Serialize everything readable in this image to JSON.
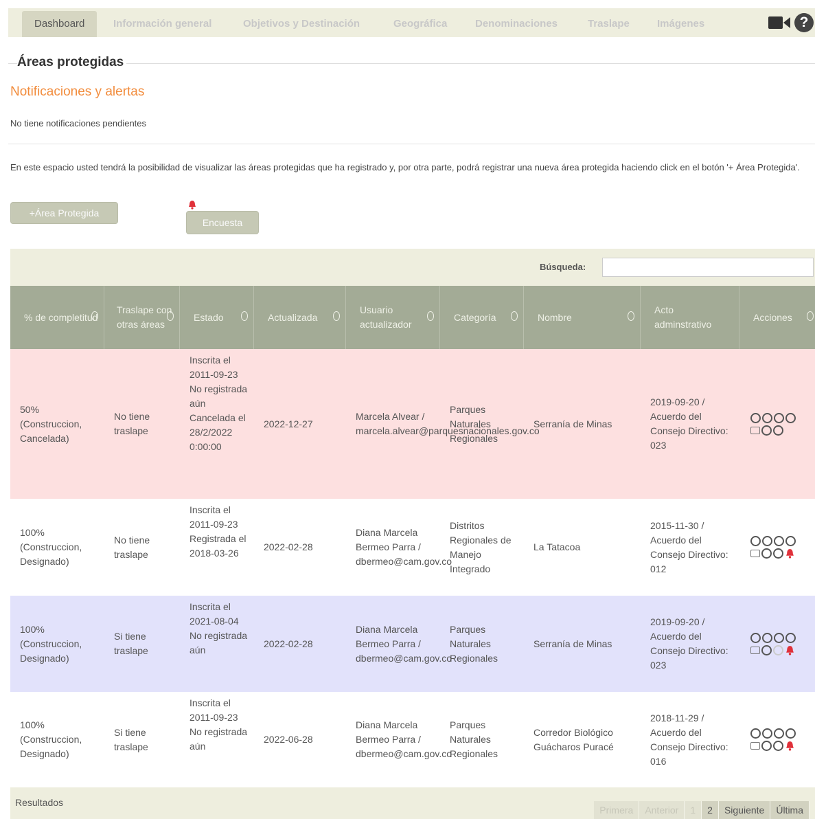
{
  "tabs": [
    {
      "label": "Dashboard",
      "active": true
    },
    {
      "label": "Información general"
    },
    {
      "label": "Objetivos y Destinación"
    },
    {
      "label": "Geográfica"
    },
    {
      "label": "Denominaciones"
    },
    {
      "label": "Traslape"
    },
    {
      "label": "Imágenes"
    }
  ],
  "icons": {
    "video": "video-camera-icon",
    "help": "question-circle-icon",
    "help_glyph": "?"
  },
  "section": {
    "title": "Áreas protegidas"
  },
  "notifications": {
    "title": "Notificaciones y alertas",
    "text": "No tiene notificaciones pendientes"
  },
  "intro": "En este espacio usted tendrá la posibilidad de visualizar las áreas protegidas que ha registrado y, por otra parte, podrá registrar una nueva área protegida haciendo click en el botón '+ Área Protegida'.",
  "buttons": {
    "add_area": "+Área Protegida",
    "survey": "Encuesta"
  },
  "search": {
    "label": "Búsqueda:",
    "value": ""
  },
  "columns": [
    "% de completitud",
    "Traslape con otras áreas",
    "Estado",
    "Actualizada",
    "Usuario actualizador",
    "Categoría",
    "Nombre",
    "Acto adminstrativo",
    "Acciones"
  ],
  "rows": [
    {
      "completitud": "50% (Construccion, Cancelada)",
      "traslape": "No tiene traslape",
      "estado": "Inscrita el 2011-09-23 No registrada aún Cancelada el 28/2/2022 0:00:00",
      "actualizada": "2022-12-27",
      "usuario": "Marcela Alvear / marcela.alvear@parquesnacionales.gov.co",
      "categoria": "Parques Naturales Regionales",
      "nombre": "Serranía de Minas",
      "acto": "2019-09-20 / Acuerdo del Consejo Directivo: 023",
      "color": "#fde0e0",
      "bell": false,
      "faded": false
    },
    {
      "completitud": "100% (Construccion, Designado)",
      "traslape": "No tiene traslape",
      "estado": "Inscrita el 2011-09-23 Registrada el 2018-03-26",
      "actualizada": "2022-02-28",
      "usuario": "Diana Marcela Bermeo Parra / dbermeo@cam.gov.co",
      "categoria": "Distritos Regionales de Manejo Integrado",
      "nombre": "La Tatacoa",
      "acto": "2015-11-30 / Acuerdo del Consejo Directivo: 012",
      "color": "#ffffff",
      "bell": true,
      "faded": false
    },
    {
      "completitud": "100% (Construccion, Designado)",
      "traslape": "Si tiene traslape",
      "estado": "Inscrita el 2021-08-04 No registrada aún",
      "actualizada": "2022-02-28",
      "usuario": "Diana Marcela Bermeo Parra / dbermeo@cam.gov.co",
      "categoria": "Parques Naturales Regionales",
      "nombre": "Serranía de Minas",
      "acto": "2019-09-20 / Acuerdo del Consejo Directivo: 023",
      "color": "#e2e2fb",
      "bell": true,
      "faded": true
    },
    {
      "completitud": "100% (Construccion, Designado)",
      "traslape": "Si tiene traslape",
      "estado": "Inscrita el 2011-09-23 No registrada aún",
      "actualizada": "2022-06-28",
      "usuario": "Diana Marcela Bermeo Parra / dbermeo@cam.gov.co",
      "categoria": "Parques Naturales Regionales",
      "nombre": "Corredor Biológico Guácharos Puracé",
      "acto": "2018-11-29 / Acuerdo del Consejo Directivo: 016",
      "color": "#ffffff",
      "bell": true,
      "faded": false
    }
  ],
  "footer": {
    "results": "Resultados"
  },
  "pagination": [
    "Primera",
    "Anterior",
    "1",
    "2",
    "Siguiente",
    "Última"
  ],
  "pagination_active": [
    "2",
    "Siguiente",
    "Última"
  ],
  "colors": {
    "accent": "#f28c3c",
    "header": "#a3ab96",
    "bell": "#e0313a"
  }
}
